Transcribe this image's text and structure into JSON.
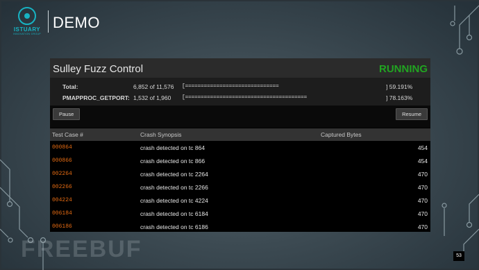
{
  "slide": {
    "logo_name": "ISTUARY",
    "logo_sub": "INNOVATION GROUP",
    "title": "DEMO",
    "page_number": "53",
    "watermark": "FREEBUF"
  },
  "app": {
    "title": "Sulley Fuzz Control",
    "status": "RUNNING",
    "colors": {
      "status": "#21a421",
      "test_case": "#e36a12"
    }
  },
  "stats": [
    {
      "label": "Total:",
      "count": "6,852  of 11,576",
      "bar": "[==============================",
      "pct": "] 59.191%"
    },
    {
      "label": "PMAPPROC_GETPORT:",
      "count": "1,532 of 1,960",
      "bar": "[=======================================",
      "pct": "] 78.163%"
    }
  ],
  "buttons": {
    "pause": "Pause",
    "resume": "Resume"
  },
  "table": {
    "headers": [
      "Test Case #",
      "Crash Synopsis",
      "Captured Bytes"
    ],
    "rows": [
      {
        "case": "000864",
        "synopsis": "crash detected on tc 864",
        "bytes": "454"
      },
      {
        "case": "000866",
        "synopsis": "crash detected on tc 866",
        "bytes": "454"
      },
      {
        "case": "002264",
        "synopsis": "crash detected on tc 2264",
        "bytes": "470"
      },
      {
        "case": "002266",
        "synopsis": "crash detected on tc 2266",
        "bytes": "470"
      },
      {
        "case": "004224",
        "synopsis": "crash detected on tc 4224",
        "bytes": "470"
      },
      {
        "case": "006184",
        "synopsis": "crash detected on tc 6184",
        "bytes": "470"
      },
      {
        "case": "006186",
        "synopsis": "crash detected on tc 6186",
        "bytes": "470"
      }
    ]
  }
}
